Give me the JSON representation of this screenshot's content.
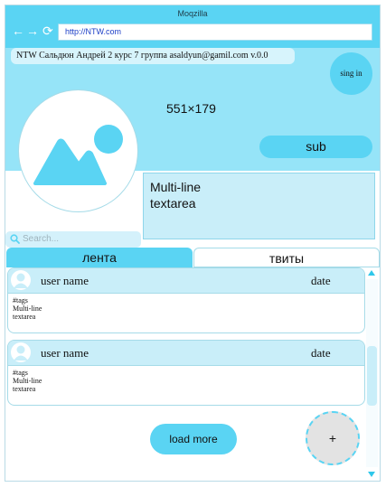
{
  "window": {
    "title": "Moqzilla"
  },
  "browser": {
    "address": "http://NTW.com",
    "back_icon": "arrow-left-icon",
    "forward_icon": "arrow-right-icon",
    "reload_icon": "reload-icon"
  },
  "profile": {
    "info": "NTW Сальдюн Андрей 2 курс 7 группа  asaldyun@gamil.com  v.0.0",
    "signin_label": "sing in",
    "banner_size": "551×179",
    "sub_label": "sub",
    "avatar_icon": "image-placeholder-icon",
    "textarea": "Multi-line\ntextarea"
  },
  "search": {
    "placeholder": "Search...",
    "icon": "search-icon"
  },
  "tabs": [
    {
      "label": "лента",
      "active": true
    },
    {
      "label": "твиты",
      "active": false
    }
  ],
  "feed": {
    "items": [
      {
        "user": "user name",
        "date": "date",
        "tags": "#tags",
        "line1": "Multi-line",
        "line2": "textarea"
      },
      {
        "user": "user name",
        "date": "date",
        "tags": "#tags",
        "line1": "Multi-line",
        "line2": "textarea"
      }
    ],
    "load_more_label": "load more",
    "add_label": "+"
  },
  "colors": {
    "accent": "#5ad4f3",
    "header_bg": "#96e4f8",
    "light": "#c9eef9",
    "link": "#1d3fc7"
  }
}
